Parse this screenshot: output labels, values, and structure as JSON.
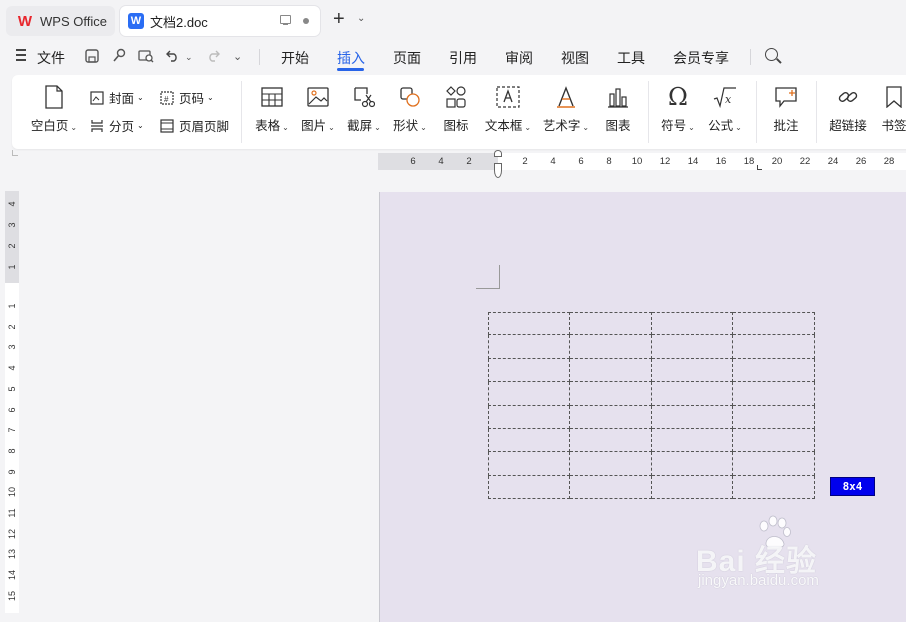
{
  "tabs": {
    "wps_home": "WPS Office",
    "document": "文档2.doc"
  },
  "menubar": {
    "file": "文件",
    "items": [
      "开始",
      "插入",
      "页面",
      "引用",
      "审阅",
      "视图",
      "工具",
      "会员专享"
    ],
    "active": "插入"
  },
  "ribbon": {
    "blank_page": "空白页",
    "cover": "封面",
    "page_number": "页码",
    "section_break": "分页",
    "header_footer": "页眉页脚",
    "table": "表格",
    "picture": "图片",
    "screenshot": "截屏",
    "shape": "形状",
    "icon": "图标",
    "textbox": "文本框",
    "wordart": "艺术字",
    "chart": "图表",
    "symbol": "符号",
    "formula": "公式",
    "comment": "批注",
    "hyperlink": "超链接",
    "bookmark": "书签"
  },
  "ruler": {
    "horizontal": [
      "6",
      "4",
      "2",
      "2",
      "4",
      "6",
      "8",
      "10",
      "12",
      "14",
      "16",
      "18",
      "20",
      "22",
      "24",
      "26",
      "28"
    ],
    "vertical_top": [
      "4",
      "3",
      "2",
      "1"
    ],
    "vertical_main": [
      "1",
      "2",
      "3",
      "4",
      "5",
      "6",
      "7",
      "8",
      "9",
      "10",
      "11",
      "12",
      "13",
      "14",
      "15"
    ]
  },
  "table_preview": {
    "columns": 4,
    "rows": 8,
    "size_label": "8x4"
  },
  "watermark": {
    "brand": "Bai 经验",
    "url": "jingyan.baidu.com"
  },
  "colors": {
    "accent": "#2864e8",
    "page": "#e6e1ee",
    "badge": "#0000ee"
  }
}
